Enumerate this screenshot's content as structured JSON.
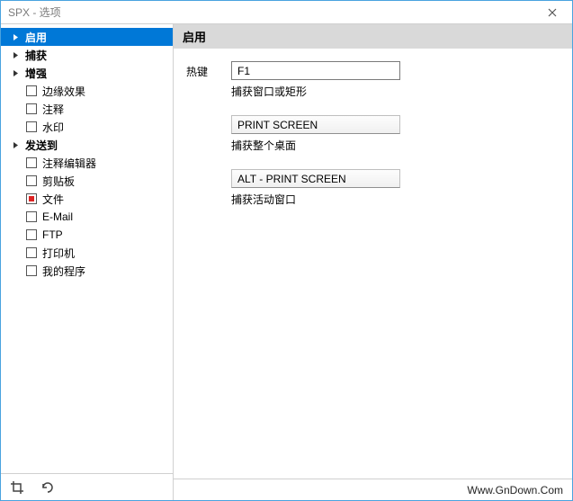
{
  "window": {
    "title": "SPX - 选项"
  },
  "sidebar": {
    "nodes": [
      {
        "label": "启用",
        "selected": true,
        "children": []
      },
      {
        "label": "捕获",
        "selected": false,
        "children": []
      },
      {
        "label": "增强",
        "selected": false,
        "children": [
          {
            "label": "边缘效果",
            "checked": false
          },
          {
            "label": "注释",
            "checked": false
          },
          {
            "label": "水印",
            "checked": false
          }
        ]
      },
      {
        "label": "发送到",
        "selected": false,
        "children": [
          {
            "label": "注释编辑器",
            "checked": false
          },
          {
            "label": "剪贴板",
            "checked": false
          },
          {
            "label": "文件",
            "checked": true
          },
          {
            "label": "E-Mail",
            "checked": false
          },
          {
            "label": "FTP",
            "checked": false
          },
          {
            "label": "打印机",
            "checked": false
          },
          {
            "label": "我的程序",
            "checked": false
          }
        ]
      }
    ]
  },
  "content": {
    "heading": "启用",
    "hotkey_label": "热键",
    "entries": [
      {
        "value": "F1",
        "desc": "捕获窗口或矩形",
        "editable": true
      },
      {
        "value": "PRINT SCREEN",
        "desc": "捕获整个桌面",
        "editable": false
      },
      {
        "value": "ALT - PRINT SCREEN",
        "desc": "捕获活动窗口",
        "editable": false
      }
    ]
  },
  "footer": {
    "text": "Www.GnDown.Com"
  }
}
